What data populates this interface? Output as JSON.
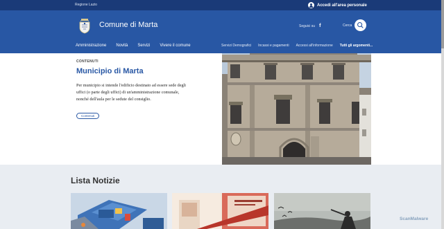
{
  "slim_header": {
    "region": "Regione Lazio",
    "login_label": "Accedi all'area personale"
  },
  "header": {
    "brand": "Comune di Marta",
    "follow_label": "Seguici su",
    "facebook_glyph": "f",
    "search_label": "Cerca"
  },
  "nav_main": [
    "Amministrazione",
    "Novità",
    "Servizi",
    "Vivere il comune"
  ],
  "nav_secondary": [
    "Servizi Demografici",
    "Incassi e pagamenti",
    "Accessi all'informazione",
    "Tutti gli argomenti..."
  ],
  "content": {
    "category": "CONTENUTI",
    "title": "Municipio di Marta",
    "description": "Per municipio si intende l'edificio destinato ad essere sede degli uffici (o parte degli uffici) di un'amministrazione comunale, nonché dell'aula per le sedute del consiglio.",
    "tag": "Contenuti"
  },
  "news": {
    "title": "Lista Notizie"
  },
  "watermark": "ScanMalware",
  "colors": {
    "primary": "#2857a4",
    "dark": "#1a3a78",
    "news_bg": "#e9edf2"
  },
  "icons": [
    "user-icon",
    "facebook-icon",
    "search-icon",
    "coat-of-arms-logo"
  ]
}
